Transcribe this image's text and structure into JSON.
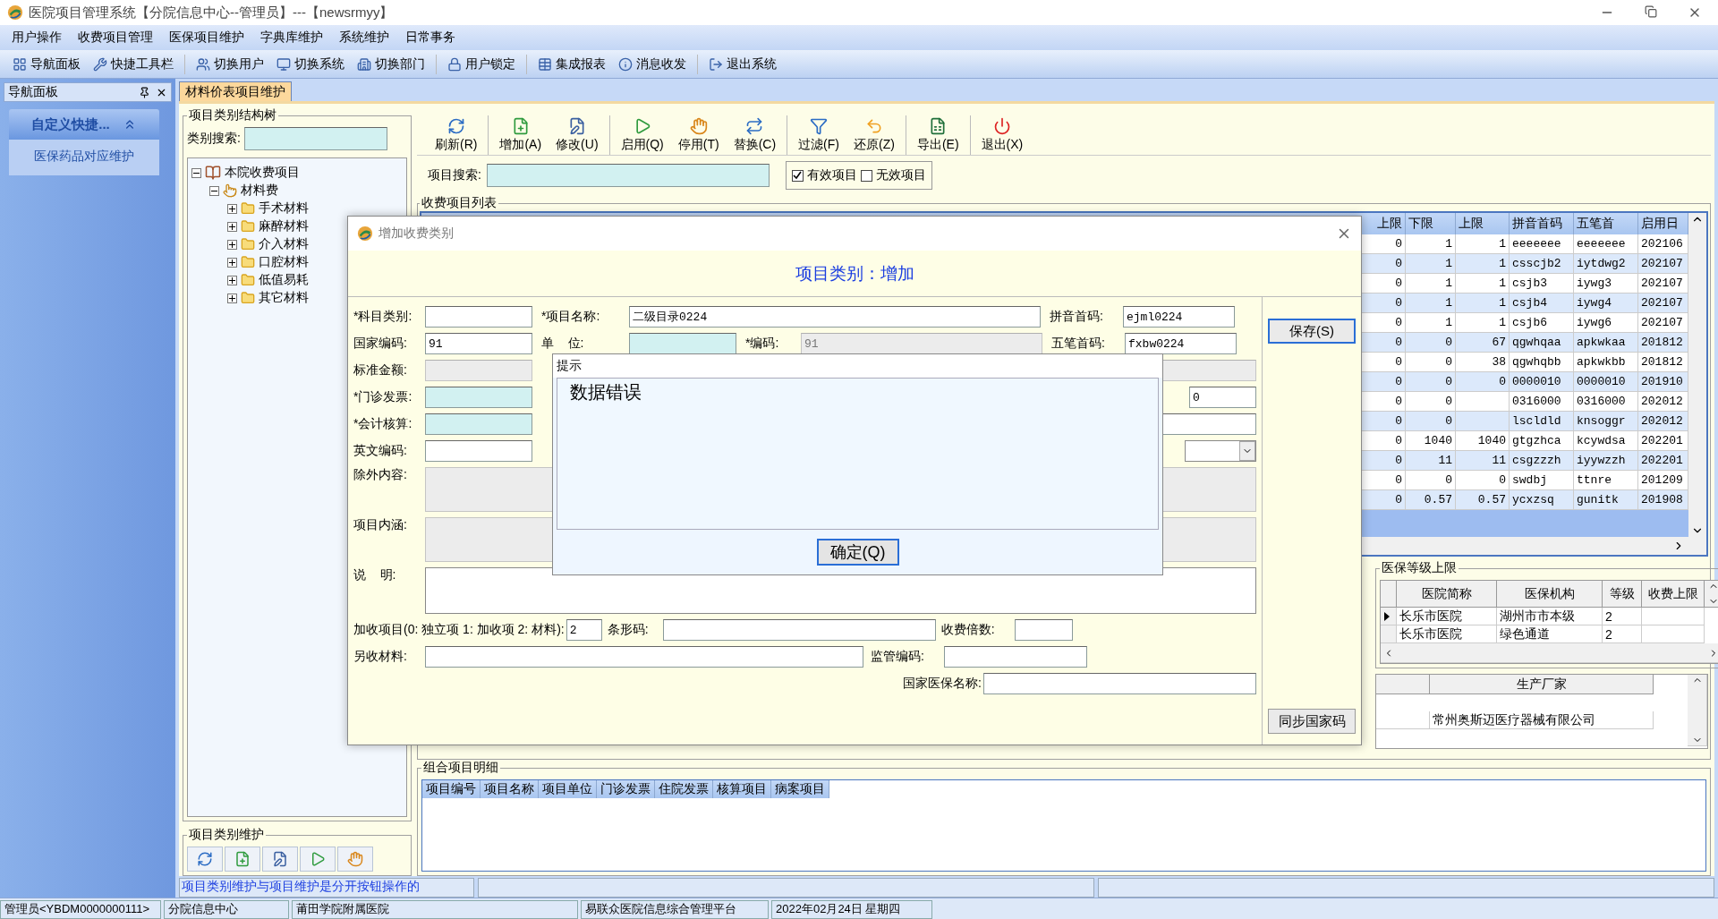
{
  "window": {
    "title": "医院项目管理系统【分院信息中心--管理员】---【newsrmyy】"
  },
  "menu": [
    "用户操作",
    "收费项目管理",
    "医保项目维护",
    "字典库维护",
    "系统维护",
    "日常事务"
  ],
  "toolbar": [
    "导航面板",
    "快捷工具栏",
    "切换用户",
    "切换系统",
    "切换部门",
    "用户锁定",
    "集成报表",
    "消息收发",
    "退出系统"
  ],
  "nav": {
    "title": "导航面板",
    "section": "自定义快捷...",
    "items": [
      "医保药品对应维护"
    ]
  },
  "tabs": [
    {
      "label": "材料价表项目维护",
      "selected": true
    }
  ],
  "tree_panel": {
    "title": "项目类别结构树",
    "search_label": "类别搜索:",
    "tree": [
      {
        "label": "本院收费项目",
        "expanded": true,
        "children": [
          {
            "label": "材料费",
            "expanded": true,
            "children": [
              {
                "label": "手术材料",
                "expanded": false
              },
              {
                "label": "麻醉材料",
                "expanded": false
              },
              {
                "label": "介入材料",
                "expanded": false
              },
              {
                "label": "口腔材料",
                "expanded": false
              },
              {
                "label": "低值易耗",
                "expanded": false
              },
              {
                "label": "其它材料",
                "expanded": false
              }
            ]
          }
        ]
      }
    ],
    "maintenance_title": "项目类别维护"
  },
  "actions": [
    "刷新(R)",
    "增加(A)",
    "修改(U)",
    "启用(Q)",
    "停用(T)",
    "替换(C)",
    "过滤(F)",
    "还原(Z)",
    "导出(E)",
    "退出(X)"
  ],
  "search": {
    "label": "项目搜索:",
    "filters": [
      {
        "label": "有效项目",
        "checked": true
      },
      {
        "label": "无效项目",
        "checked": false
      }
    ]
  },
  "list": {
    "title": "收费项目列表",
    "columns": [
      "上限",
      "下限",
      "上限",
      "拼音首码",
      "五笔首",
      "启用日"
    ],
    "rows": [
      [
        "0",
        "1",
        "1",
        "eeeeeee",
        "eeeeeee",
        "202106"
      ],
      [
        "0",
        "1",
        "1",
        "csscjb2",
        "iytdwg2",
        "202107"
      ],
      [
        "0",
        "1",
        "1",
        "csjb3",
        "iywg3",
        "202107"
      ],
      [
        "0",
        "1",
        "1",
        "csjb4",
        "iywg4",
        "202107"
      ],
      [
        "0",
        "1",
        "1",
        "csjb6",
        "iywg6",
        "202107"
      ],
      [
        "0",
        "0",
        "67",
        "qgwhqaa",
        "apkwkaa",
        "201812"
      ],
      [
        "0",
        "0",
        "38",
        "qgwhqbb",
        "apkwkbb",
        "201812"
      ],
      [
        "0",
        "0",
        "0",
        "0000010",
        "0000010",
        "201910"
      ],
      [
        "0",
        "0",
        null,
        "0316000",
        "0316000",
        "202012"
      ],
      [
        "0",
        "0",
        null,
        "lscldld",
        "knsoggr",
        "202012"
      ],
      [
        "0",
        "1040",
        "1040",
        "gtgzhca",
        "kcywdsa",
        "202201"
      ],
      [
        "0",
        "11",
        "11",
        "csgzzzh",
        "iyywzzh",
        "202201"
      ],
      [
        "0",
        "0",
        "0",
        "swdbj",
        "ttnre",
        "201209"
      ],
      [
        "0",
        "0.57",
        "0.57",
        "ycxzsq",
        "gunitk",
        "201908"
      ]
    ]
  },
  "insurance_limits": {
    "title": "医保等级上限",
    "columns": [
      "医院简称",
      "医保机构",
      "等级",
      "收费上限"
    ],
    "rows": [
      {
        "cells": [
          "长乐市医院",
          "湖州市市本级",
          "2"
        ],
        "current": true
      },
      {
        "cells": [
          "长乐市医院",
          "绿色通道",
          "2"
        ],
        "current": false
      }
    ]
  },
  "manufacturer": {
    "columns": [
      "生产厂家"
    ],
    "rows": [
      [
        "常州奥斯迈医疗器械有限公司"
      ]
    ]
  },
  "combo": {
    "title": "组合项目明细",
    "columns": [
      "项目编号",
      "项目名称",
      "项目单位",
      "门诊发票",
      "住院发票",
      "核算项目",
      "病案项目"
    ]
  },
  "hint": "项目类别维护与项目维护是分开按钮操作的",
  "status_bar": [
    "管理员<YBDM0000000111>",
    "分院信息中心",
    "莆田学院附属医院",
    "易联众医院信息综合管理平台",
    "2022年02月24日 星期四"
  ],
  "dialog": {
    "title": "增加收费类别",
    "heading": "项目类别：增加",
    "buttons": [
      "保存(S)",
      "同步国家码"
    ],
    "fields": [
      {
        "label": "*科目类别:",
        "kind": "input",
        "highlighted": false,
        "disabled": false
      },
      {
        "label": "*项目名称:",
        "value": "二级目录0224",
        "kind": "input",
        "highlighted": false,
        "disabled": false
      },
      {
        "label": "拼音首码:",
        "value": "ejml0224",
        "kind": "input",
        "highlighted": false,
        "disabled": false
      },
      {
        "label": "国家编码:",
        "value": "91",
        "kind": "input",
        "highlighted": false,
        "disabled": false
      },
      {
        "label": "单    位:",
        "kind": "input",
        "highlighted": true,
        "disabled": false
      },
      {
        "label": "*编码:",
        "value": "91",
        "kind": "input",
        "highlighted": false,
        "disabled": true
      },
      {
        "label": "五笔首码:",
        "value": "fxbw0224",
        "kind": "input",
        "highlighted": false,
        "disabled": false
      },
      {
        "label": "标准金额:",
        "kind": "input",
        "highlighted": false,
        "disabled": true
      },
      {
        "kind": "input",
        "highlighted": false,
        "disabled": true
      },
      {
        "label": "*门诊发票:",
        "kind": "input",
        "highlighted": true,
        "disabled": false
      },
      {
        "value": "0",
        "kind": "input",
        "highlighted": false,
        "disabled": false
      },
      {
        "label": "*会计核算:",
        "kind": "input",
        "highlighted": true,
        "disabled": false
      },
      {
        "kind": "input",
        "highlighted": false,
        "disabled": false
      },
      {
        "label": "英文编码:",
        "kind": "input",
        "highlighted": false,
        "disabled": false
      },
      {
        "kind": "select",
        "highlighted": false,
        "disabled": false
      },
      {
        "label": "除外内容:",
        "kind": "area",
        "highlighted": false,
        "disabled": true
      },
      {
        "label": "项目内涵:",
        "kind": "area",
        "highlighted": false,
        "disabled": true
      },
      {
        "label": "说    明:",
        "kind": "area",
        "highlighted": false,
        "disabled": false
      },
      {
        "label": "加收项目(0: 独立项 1: 加收项 2: 材料):",
        "value": "2",
        "kind": "input",
        "highlighted": false,
        "disabled": false
      },
      {
        "label": "条形码:",
        "kind": "input",
        "highlighted": false,
        "disabled": false
      },
      {
        "label": "收费倍数:",
        "kind": "input",
        "highlighted": false,
        "disabled": false
      },
      {
        "label": "另收材料:",
        "kind": "input",
        "highlighted": false,
        "disabled": false
      },
      {
        "label": "监管编码:",
        "kind": "input",
        "highlighted": false,
        "disabled": false
      },
      {
        "label": "国家医保名称:",
        "kind": "input",
        "highlighted": false,
        "disabled": false
      }
    ]
  },
  "message_box": {
    "title": "提示",
    "message": "数据错误",
    "button": "确定(Q)"
  }
}
